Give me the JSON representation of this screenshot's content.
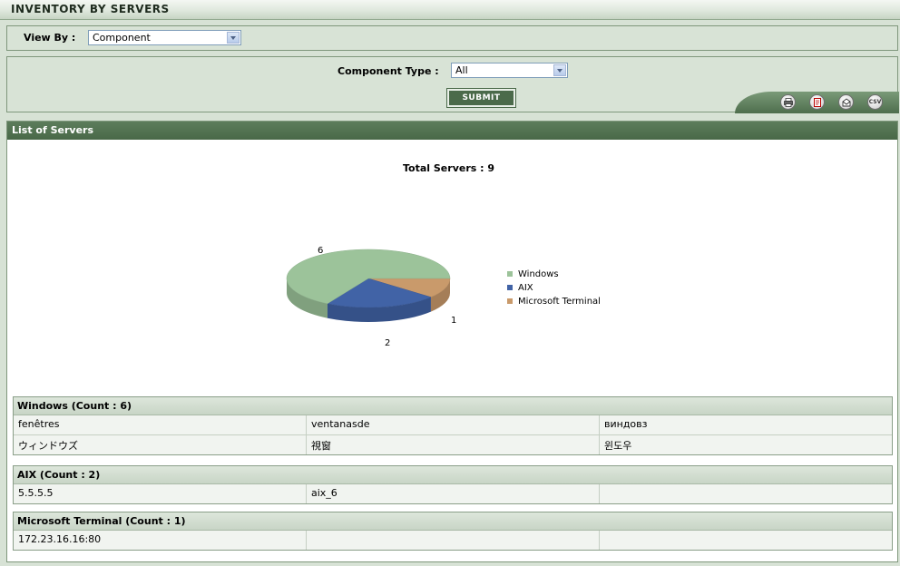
{
  "header": {
    "title": "INVENTORY BY SERVERS"
  },
  "viewby": {
    "label": "View By  :",
    "selected": "Component"
  },
  "filter": {
    "label": "Component Type :",
    "selected": "All",
    "submit_label": "SUBMIT"
  },
  "export": {
    "icons": [
      {
        "name": "print-icon"
      },
      {
        "name": "pdf-icon"
      },
      {
        "name": "email-icon"
      },
      {
        "name": "csv-icon",
        "text": "CSV"
      }
    ]
  },
  "list": {
    "title": "List of Servers"
  },
  "chart_data": {
    "type": "pie",
    "title": "Total Servers : 9",
    "categories": [
      "Windows",
      "AIX",
      "Microsoft Terminal"
    ],
    "values": [
      6,
      2,
      1
    ],
    "colors": [
      "#9cc39a",
      "#4163a6",
      "#c99a6b"
    ],
    "legend_position": "right"
  },
  "groups": [
    {
      "title": "Windows  (Count : 6)",
      "rows": [
        [
          "fenêtres",
          "ventanasde",
          "виндовз"
        ],
        [
          "ウィンドウズ",
          "視窗",
          "윈도우"
        ]
      ]
    },
    {
      "title": "AIX  (Count : 2)",
      "rows": [
        [
          "5.5.5.5",
          "aix_6",
          ""
        ]
      ]
    },
    {
      "title": "Microsoft Terminal  (Count : 1)",
      "rows": [
        [
          "172.23.16.16:80",
          "",
          ""
        ]
      ]
    }
  ]
}
